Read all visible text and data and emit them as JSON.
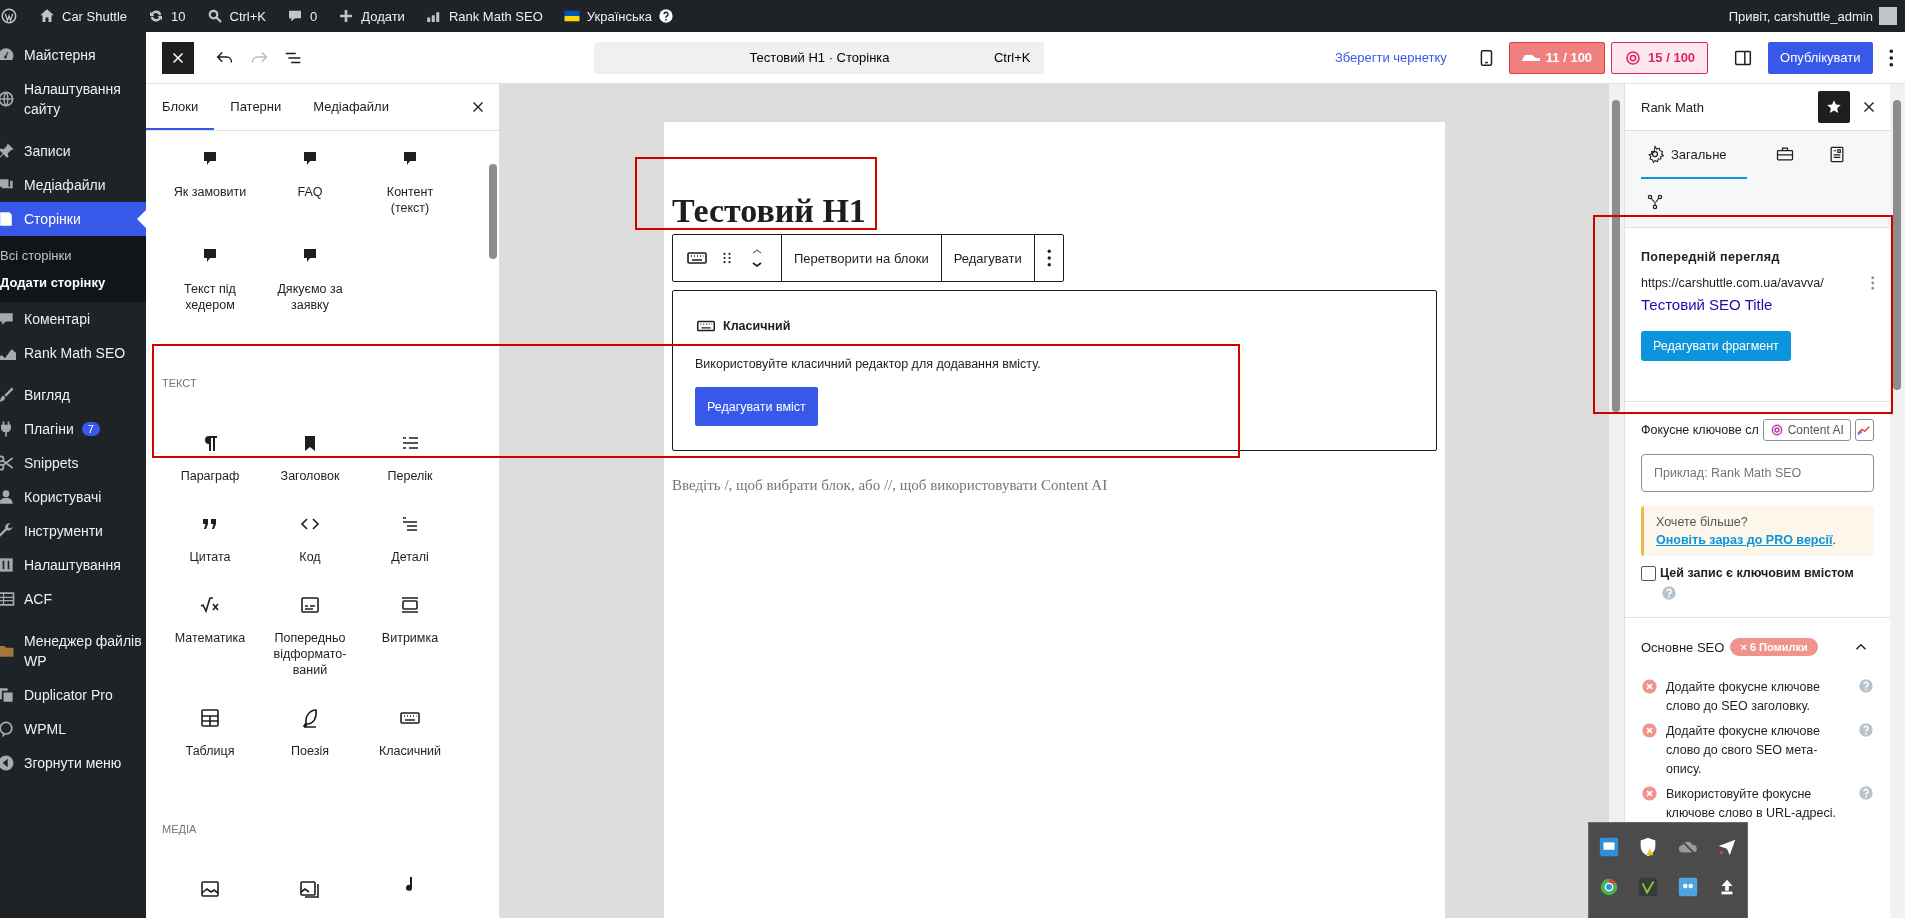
{
  "admin_bar": {
    "items": [
      {
        "kind": "logo"
      },
      {
        "kind": "home",
        "label": "Car Shuttle"
      },
      {
        "kind": "updates",
        "label": "10"
      },
      {
        "kind": "search",
        "label": "Ctrl+K"
      },
      {
        "kind": "comments",
        "label": "0"
      },
      {
        "kind": "add",
        "label": "Додати"
      },
      {
        "kind": "rankmath",
        "label": "Rank Math SEO"
      },
      {
        "kind": "language",
        "label": "Українська"
      }
    ],
    "greeting": "Привіт, carshuttle_admin"
  },
  "admin_menu": {
    "groups": [
      {
        "items": [
          {
            "kind": "dashboard",
            "label": "Майстерня",
            "selected": false
          },
          {
            "kind": "site",
            "label": "Налаштування сайту",
            "selected": false
          }
        ]
      },
      {
        "items": [
          {
            "kind": "posts",
            "label": "Записи",
            "selected": false
          },
          {
            "kind": "media",
            "label": "Медіафайли",
            "selected": false
          },
          {
            "kind": "pages",
            "label": "Сторінки",
            "selected": true,
            "children": [
              {
                "label": "Всі сторінки",
                "selected": false
              },
              {
                "label": "Додати сторінку",
                "selected": true
              }
            ]
          },
          {
            "kind": "comments",
            "label": "Коментарі",
            "selected": false
          },
          {
            "kind": "rankmath",
            "label": "Rank Math SEO",
            "selected": false
          }
        ]
      },
      {
        "items": [
          {
            "kind": "appearance",
            "label": "Вигляд",
            "selected": false
          },
          {
            "kind": "plugins",
            "label": "Плагіни",
            "badge": "7",
            "selected": false
          },
          {
            "kind": "snippets",
            "label": "Snippets",
            "selected": false
          },
          {
            "kind": "users",
            "label": "Користувачі",
            "selected": false
          },
          {
            "kind": "tools",
            "label": "Інструменти",
            "selected": false
          },
          {
            "kind": "settings",
            "label": "Налаштування",
            "selected": false
          },
          {
            "kind": "acf",
            "label": "ACF",
            "selected": false
          }
        ]
      },
      {
        "items": [
          {
            "kind": "filemanager",
            "label": "Менеджер файлів WP",
            "selected": false
          },
          {
            "kind": "duplicator",
            "label": "Duplicator Pro",
            "selected": false
          },
          {
            "kind": "wpml",
            "label": "WPML",
            "selected": false
          },
          {
            "kind": "collapse",
            "label": "Згорнути меню",
            "selected": false
          }
        ]
      }
    ]
  },
  "editor_header": {
    "document_title": "Тестовий H1 · Сторінка",
    "shortcut": "Ctrl+K",
    "save_draft": "Зберегти чернетку",
    "seo_score": "11 / 100",
    "content_ai_score": "15 / 100",
    "publish": "Опублікувати"
  },
  "inserter": {
    "tabs": [
      {
        "label": "Блоки",
        "selected": true
      },
      {
        "label": "Патерни",
        "selected": false
      },
      {
        "label": "Медіафайли",
        "selected": false
      }
    ],
    "sections": [
      {
        "items": [
          {
            "kind": "reusable",
            "label": "Як замовити"
          },
          {
            "kind": "reusable",
            "label": "FAQ"
          },
          {
            "kind": "reusable",
            "label": "Контент (текст)"
          },
          {
            "kind": "reusable",
            "label": "Текст під хедером"
          },
          {
            "kind": "reusable",
            "label": "Дякуємо за заявку"
          }
        ]
      },
      {
        "title": "ТЕКСТ",
        "items": [
          {
            "kind": "paragraph",
            "label": "Параграф"
          },
          {
            "kind": "heading",
            "label": "Заголовок"
          },
          {
            "kind": "list",
            "label": "Перелік"
          },
          {
            "kind": "quote",
            "label": "Цитата"
          },
          {
            "kind": "code",
            "label": "Код"
          },
          {
            "kind": "details",
            "label": "Деталі"
          },
          {
            "kind": "math",
            "label": "Математика"
          },
          {
            "kind": "preformatted",
            "label": "Попередньо відформато-ваний"
          },
          {
            "kind": "pullquote",
            "label": "Витримка"
          },
          {
            "kind": "table",
            "label": "Таблиця"
          },
          {
            "kind": "verse",
            "label": "Поезія"
          },
          {
            "kind": "classic",
            "label": "Класичний"
          }
        ]
      },
      {
        "title": "МЕДІА",
        "items": [
          {
            "kind": "image"
          },
          {
            "kind": "gallery"
          },
          {
            "kind": "audio"
          }
        ]
      }
    ]
  },
  "canvas": {
    "title": "Тестовий H1",
    "toolbar": {
      "convert": "Перетворити на блоки",
      "edit": "Редагувати"
    },
    "classic_block": {
      "title": "Класичний",
      "description": "Використовуйте класичний редактор для додавання вмісту.",
      "button": "Редагувати вміст"
    },
    "placeholder": "Введіть /, щоб вибрати блок, або //, щоб використовувати Content AI"
  },
  "rank_math": {
    "title": "Rank Math",
    "tabs": [
      {
        "kind": "general",
        "label": "Загальне",
        "selected": true
      },
      {
        "kind": "advanced",
        "selected": false
      },
      {
        "kind": "schema",
        "selected": false
      },
      {
        "kind": "social",
        "selected": false
      }
    ],
    "preview": {
      "heading": "Попередній перегляд",
      "url": "https://carshuttle.com.ua/avavva/",
      "title": "Тестовий SEO Title",
      "button": "Редагувати фрагмент"
    },
    "focus_keyword": {
      "label": "Фокусне ключове сл",
      "content_ai": "Content AI",
      "placeholder": "Приклад: Rank Math SEO"
    },
    "upsell": {
      "text": "Хочете більше?",
      "link": "Оновіть зараз до PRO версії",
      "end": "."
    },
    "pillar": {
      "label": "Цей запис є ключовим вмістом",
      "checked": false
    },
    "basic_seo": {
      "title": "Основне SEO",
      "badge": "× 6 Помилки",
      "expanded": true,
      "checks": [
        {
          "text": "Додайте фокусне ключове слово до SEO заголовку.",
          "passed": false
        },
        {
          "text": "Додайте фокусне ключове слово до свого SEO мета-опису.",
          "passed": false
        },
        {
          "text": "Використовуйте фокусне ключове слово в URL-адресі.",
          "passed": false
        }
      ]
    }
  }
}
